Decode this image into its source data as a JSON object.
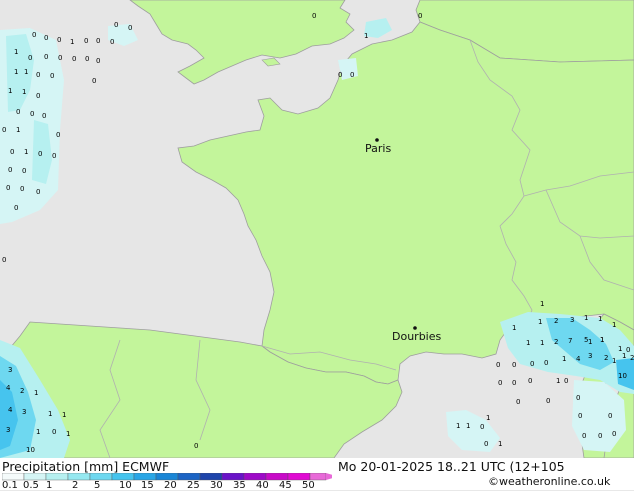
{
  "colors": {
    "sea": "#e6e6e6",
    "land": "#c3f59b",
    "border": "#b0b0b0",
    "coast": "#9e9e9e"
  },
  "cities": [
    {
      "name": "Paris"
    },
    {
      "name": "Dourbies"
    }
  ],
  "cells": [
    {
      "v": "0"
    },
    {
      "v": "1"
    },
    {
      "v": "0"
    },
    {
      "v": "0"
    },
    {
      "v": "1"
    },
    {
      "v": "0"
    },
    {
      "v": "0"
    },
    {
      "v": "0"
    },
    {
      "v": "0"
    },
    {
      "v": "0"
    },
    {
      "v": "0"
    },
    {
      "v": "0"
    },
    {
      "v": "1"
    },
    {
      "v": "0"
    },
    {
      "v": "0"
    },
    {
      "v": "0"
    },
    {
      "v": "0"
    },
    {
      "v": "0"
    },
    {
      "v": "0"
    },
    {
      "v": "1"
    },
    {
      "v": "1"
    },
    {
      "v": "0"
    },
    {
      "v": "0"
    },
    {
      "v": "0"
    },
    {
      "v": "0"
    },
    {
      "v": "0"
    },
    {
      "v": "0"
    },
    {
      "v": "1"
    },
    {
      "v": "1"
    },
    {
      "v": "0"
    },
    {
      "v": "0"
    },
    {
      "v": "1"
    },
    {
      "v": "0"
    },
    {
      "v": "0"
    },
    {
      "v": "0"
    },
    {
      "v": "0"
    },
    {
      "v": "0"
    },
    {
      "v": "0"
    },
    {
      "v": "0"
    },
    {
      "v": "0"
    },
    {
      "v": "1"
    },
    {
      "v": "0"
    },
    {
      "v": "0"
    },
    {
      "v": "0"
    },
    {
      "v": "0"
    },
    {
      "v": "1"
    },
    {
      "v": "1"
    },
    {
      "v": "1"
    },
    {
      "v": "1"
    },
    {
      "v": "1"
    },
    {
      "v": "1"
    },
    {
      "v": "2"
    },
    {
      "v": "3"
    },
    {
      "v": "1"
    },
    {
      "v": "1"
    },
    {
      "v": "1"
    },
    {
      "v": "2"
    },
    {
      "v": "7"
    },
    {
      "v": "5"
    },
    {
      "v": "3"
    },
    {
      "v": "1"
    },
    {
      "v": "0"
    },
    {
      "v": "1"
    },
    {
      "v": "4"
    },
    {
      "v": "1"
    },
    {
      "v": "2"
    },
    {
      "v": "0"
    },
    {
      "v": "0"
    },
    {
      "v": "0"
    },
    {
      "v": "0"
    },
    {
      "v": "1"
    },
    {
      "v": "2"
    },
    {
      "v": "1"
    },
    {
      "v": "1"
    },
    {
      "v": "10"
    },
    {
      "v": "0"
    },
    {
      "v": "0"
    },
    {
      "v": "0"
    },
    {
      "v": "1"
    },
    {
      "v": "0"
    },
    {
      "v": "0"
    },
    {
      "v": "0"
    },
    {
      "v": "0"
    },
    {
      "v": "1"
    },
    {
      "v": "0"
    },
    {
      "v": "0"
    },
    {
      "v": "1"
    },
    {
      "v": "1"
    },
    {
      "v": "0"
    },
    {
      "v": "3"
    },
    {
      "v": "0"
    },
    {
      "v": "0"
    },
    {
      "v": "1"
    },
    {
      "v": "2"
    },
    {
      "v": "1"
    },
    {
      "v": "4"
    },
    {
      "v": "3"
    },
    {
      "v": "1"
    },
    {
      "v": "1"
    },
    {
      "v": "0"
    },
    {
      "v": "0"
    },
    {
      "v": "10"
    },
    {
      "v": "4"
    },
    {
      "v": "3"
    },
    {
      "v": "1"
    },
    {
      "v": "0"
    },
    {
      "v": "1"
    },
    {
      "v": "0"
    },
    {
      "v": "0"
    }
  ],
  "footer": {
    "title": "Precipitation [mm]  ECMWF",
    "datetime": "Mo 20-01-2025 18..21 UTC (12+105",
    "credit": "©weatheronline.co.uk"
  },
  "legend": {
    "ticks": [
      "0.1",
      "0.5",
      "1",
      "2",
      "5",
      "10",
      "15",
      "20",
      "25",
      "30",
      "35",
      "40",
      "45",
      "50"
    ],
    "colors": [
      "#f5fbfb",
      "#d5f5f5",
      "#b6f0f0",
      "#95e8f0",
      "#6ed8f0",
      "#46c4ee",
      "#2aa6e6",
      "#1a86d6",
      "#1c64c4",
      "#1e44aa",
      "#6a14c8",
      "#9e0ac8",
      "#c80ac8",
      "#e00ad2",
      "#e86ad8"
    ]
  }
}
